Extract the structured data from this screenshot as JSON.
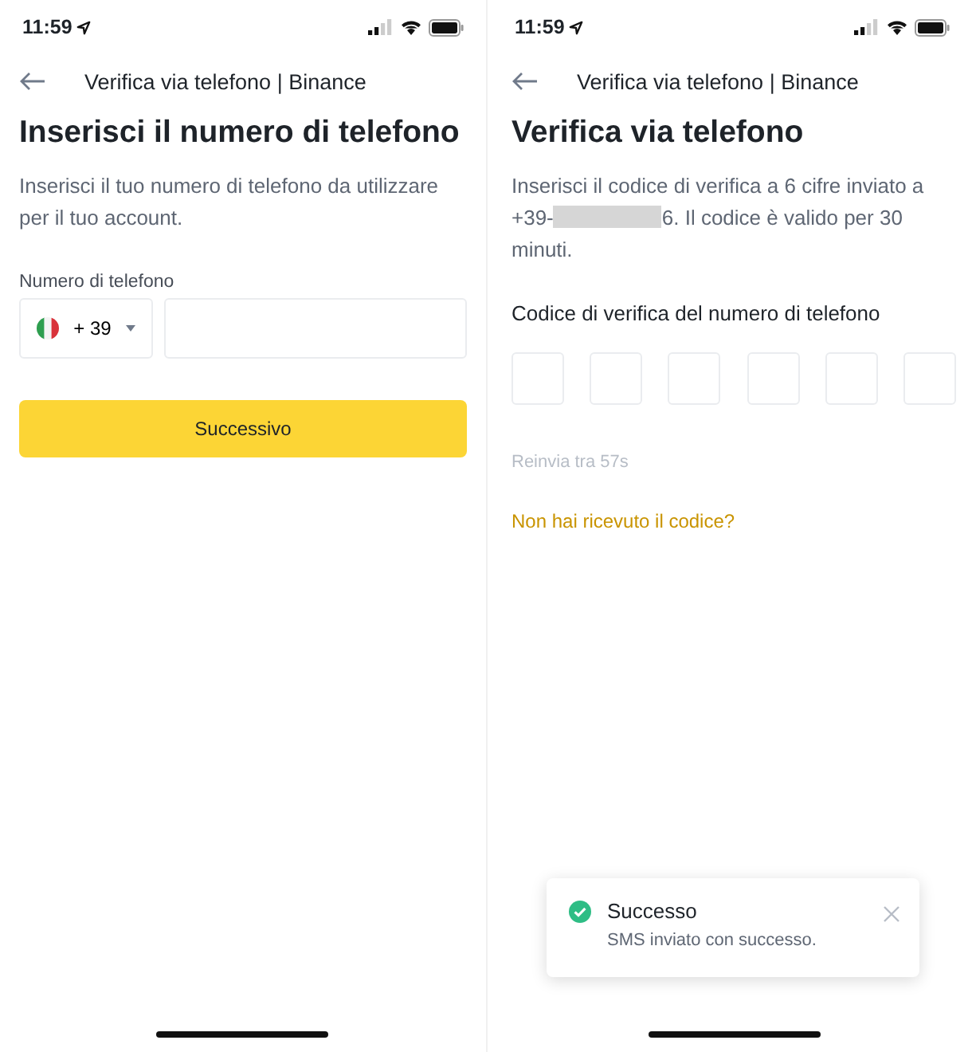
{
  "screens": [
    {
      "kind": "phone_entry",
      "status_bar": {
        "time": "11:59"
      },
      "header": {
        "title": "Verifica via telefono | Binance"
      },
      "heading": "Inserisci il numero di telefono",
      "description": "Inserisci il tuo numero di telefono da utilizzare per il tuo account.",
      "phone_label": "Numero di telefono",
      "country_code": "+ 39",
      "next_button": "Successivo"
    },
    {
      "kind": "code_entry",
      "status_bar": {
        "time": "11:59"
      },
      "header": {
        "title": "Verifica via telefono | Binance"
      },
      "heading": "Verifica via telefono",
      "description": {
        "before": "Inserisci il codice di verifica a 6 cifre inviato a +39-",
        "after": "6. Il codice è valido per 30 minuti.",
        "redacted": true
      },
      "code_label": "Codice di verifica del numero di telefono",
      "code_fields": [
        {
          "selected": false
        },
        {
          "selected": false
        },
        {
          "selected": false
        },
        {
          "selected": false
        },
        {
          "selected": false
        },
        {
          "selected": false
        }
      ],
      "resend": "Reinvia tra 57s",
      "help_link": "Non hai ricevuto il codice?",
      "toast": {
        "title": "Successo",
        "message": "SMS inviato con successo."
      }
    }
  ]
}
